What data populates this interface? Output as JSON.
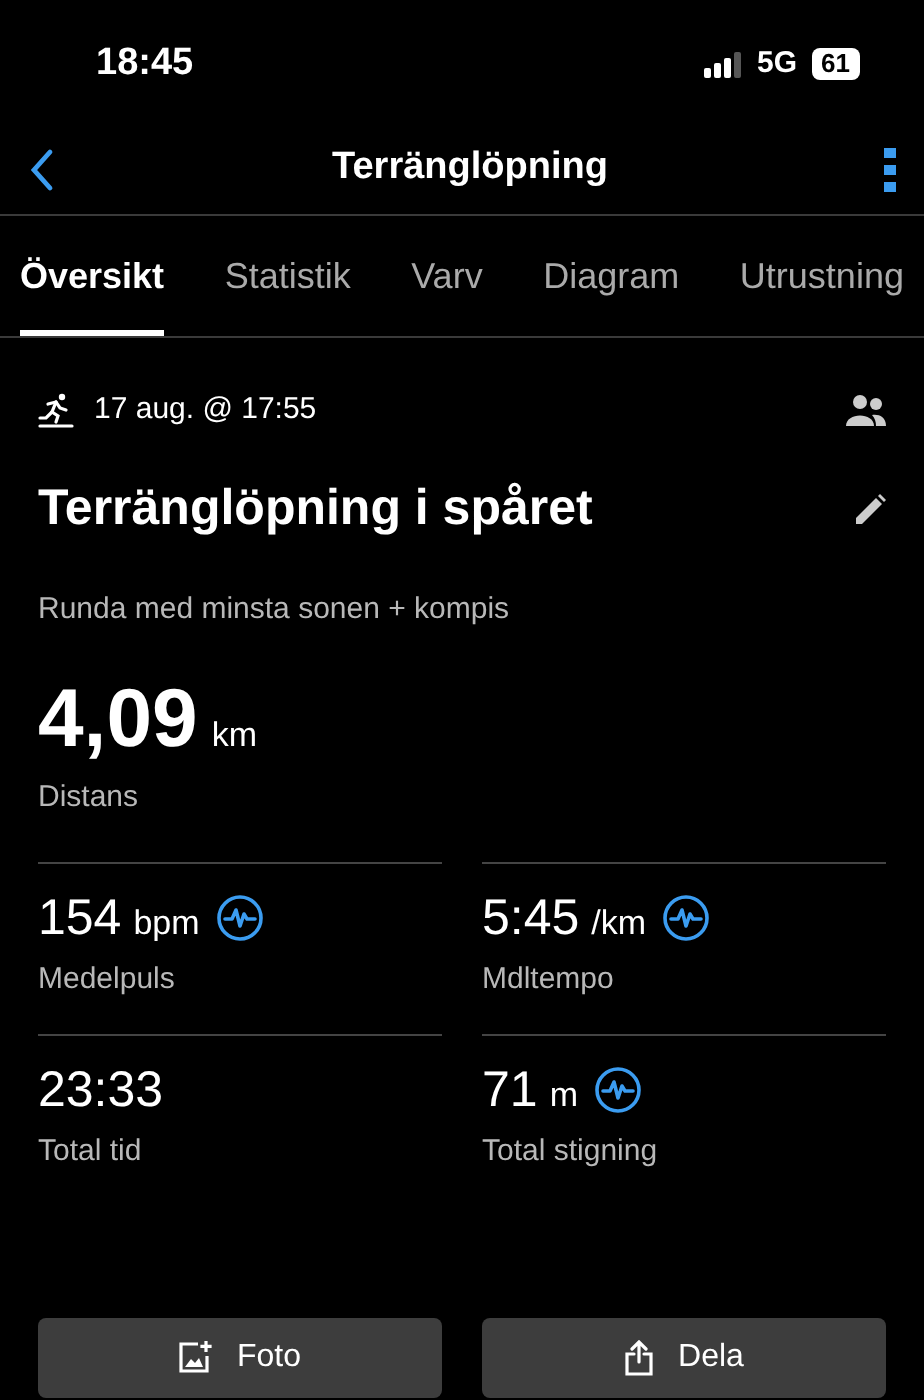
{
  "status_bar": {
    "time": "18:45",
    "network": "5G",
    "battery": "61"
  },
  "header": {
    "title": "Terränglöpning"
  },
  "tabs": [
    {
      "label": "Översikt",
      "selected": true
    },
    {
      "label": "Statistik",
      "selected": false
    },
    {
      "label": "Varv",
      "selected": false
    },
    {
      "label": "Diagram",
      "selected": false
    },
    {
      "label": "Utrustning",
      "selected": false
    }
  ],
  "activity": {
    "date": "17 aug. @ 17:55",
    "title": "Terränglöpning i spåret",
    "description": "Runda med minsta sonen + kompis"
  },
  "distance": {
    "value": "4,09",
    "unit": "km",
    "label": "Distans"
  },
  "stats": [
    {
      "value": "154",
      "unit": "bpm",
      "label": "Medelpuls",
      "chart_link": true
    },
    {
      "value": "5:45",
      "unit": "/km",
      "label": "Mdltempo",
      "chart_link": true
    },
    {
      "value": "23:33",
      "label": "Total tid",
      "chart_link": false
    },
    {
      "value": "71",
      "unit": "m",
      "label": "Total stigning",
      "chart_link": true
    }
  ],
  "buttons": [
    {
      "kind": "photo",
      "label": "Foto"
    },
    {
      "kind": "share",
      "label": "Dela"
    }
  ]
}
